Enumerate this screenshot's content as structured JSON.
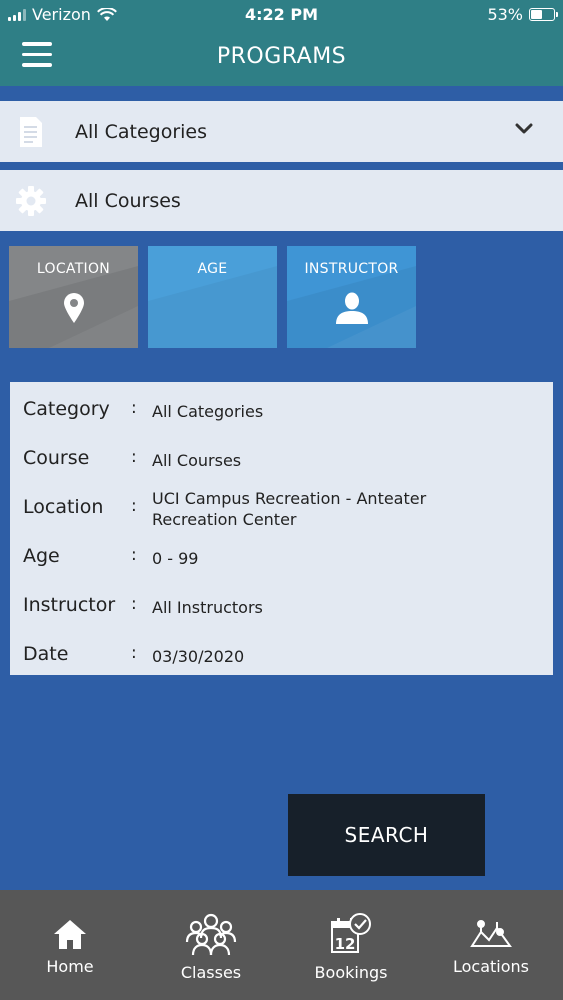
{
  "status_bar": {
    "carrier": "Verizon",
    "time": "4:22 PM",
    "battery": "53%",
    "battery_level": 0.53
  },
  "header": {
    "title": "PROGRAMS",
    "menu_icon": "hamburger-menu-icon"
  },
  "filters": {
    "category": {
      "label": "All Categories",
      "icon": "document-icon",
      "has_dropdown": true
    },
    "course": {
      "label": "All Courses",
      "icon": "gear-icon"
    }
  },
  "tiles": [
    {
      "label": "LOCATION",
      "icon": "map-pin-icon",
      "color": "#848688"
    },
    {
      "label": "AGE",
      "icon": "",
      "color": "#4a9fd9"
    },
    {
      "label": "INSTRUCTOR",
      "icon": "person-icon",
      "color": "#3f95d5"
    }
  ],
  "summary": {
    "separator": ":",
    "rows": [
      {
        "key": "Category",
        "value": "All Categories"
      },
      {
        "key": "Course",
        "value": "All Courses"
      },
      {
        "key": "Location",
        "value": "UCI Campus Recreation - Anteater Recreation Center"
      },
      {
        "key": "Age",
        "value": "0 - 99"
      },
      {
        "key": "Instructor",
        "value": "All Instructors"
      },
      {
        "key": "Date",
        "value": "03/30/2020"
      }
    ]
  },
  "search_button": {
    "label": "SEARCH"
  },
  "bottom_nav": [
    {
      "label": "Home",
      "icon": "home-icon"
    },
    {
      "label": "Classes",
      "icon": "group-icon"
    },
    {
      "label": "Bookings",
      "icon": "calendar-check-icon",
      "badge_day": "12"
    },
    {
      "label": "Locations",
      "icon": "map-icon"
    }
  ],
  "colors": {
    "header": "#2f7f86",
    "background": "#2e5ea6",
    "panel": "#e3e9f2",
    "search_button": "#17202a",
    "bottom_nav": "#575757"
  }
}
